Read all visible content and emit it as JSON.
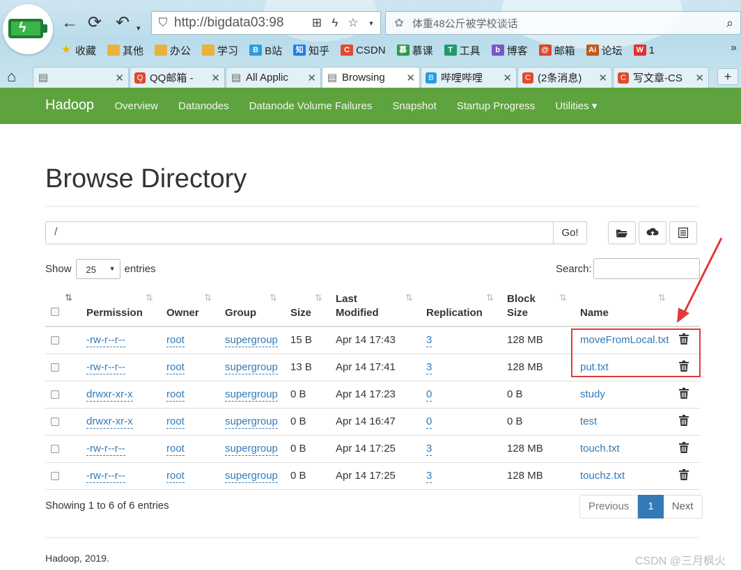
{
  "browser": {
    "url": "http://bigdata03:98",
    "search_text": "体重48公斤被学校谈话",
    "bookmarks": [
      {
        "label": "收藏",
        "icon": "star-icon",
        "color": "#f0b400"
      },
      {
        "label": "其他",
        "icon": "folder-icon",
        "color": "#e8b33a"
      },
      {
        "label": "办公",
        "icon": "folder-icon",
        "color": "#e8b33a"
      },
      {
        "label": "学习",
        "icon": "folder-icon",
        "color": "#e8b33a"
      },
      {
        "label": "B站",
        "icon": "bilibili-icon",
        "color": "#2d9be0"
      },
      {
        "label": "知乎",
        "icon": "zhihu-icon",
        "color": "#1e80e0"
      },
      {
        "label": "CSDN",
        "icon": "csdn-icon",
        "color": "#e24b2a"
      },
      {
        "label": "慕课",
        "icon": "mooc-icon",
        "color": "#2c9a45"
      },
      {
        "label": "工具",
        "icon": "tool-icon",
        "color": "#1f9b6b"
      },
      {
        "label": "博客",
        "icon": "blog-icon",
        "color": "#7b56c4"
      },
      {
        "label": "邮箱",
        "icon": "mail-icon",
        "color": "#d9472b"
      },
      {
        "label": "论坛",
        "icon": "ai-icon",
        "color": "#c05a17"
      },
      {
        "label": "1",
        "icon": "weibo-icon",
        "color": "#e0312f"
      }
    ],
    "tabs": [
      {
        "title": "",
        "icon": "page-icon",
        "color": "#888888",
        "active": false
      },
      {
        "title": "QQ邮箱 -",
        "icon": "qqmail-icon",
        "color": "#e0482c",
        "active": false
      },
      {
        "title": "All Applic",
        "icon": "page-icon",
        "color": "#888888",
        "active": false
      },
      {
        "title": "Browsing",
        "icon": "page-icon",
        "color": "#888888",
        "active": true
      },
      {
        "title": "哔哩哔哩",
        "icon": "bilibili-icon",
        "color": "#2d9be0",
        "active": false
      },
      {
        "title": "(2条消息)",
        "icon": "csdn-icon",
        "color": "#e24b2a",
        "active": false
      },
      {
        "title": "写文章-CS",
        "icon": "csdn-icon",
        "color": "#e24b2a",
        "active": false
      }
    ]
  },
  "navbar": {
    "brand": "Hadoop",
    "links": [
      "Overview",
      "Datanodes",
      "Datanode Volume Failures",
      "Snapshot",
      "Startup Progress",
      "Utilities ▾"
    ]
  },
  "page": {
    "title": "Browse Directory",
    "path": "/",
    "go_label": "Go!",
    "show_label": "Show",
    "entries_label": "entries",
    "page_size": "25",
    "search_label": "Search:"
  },
  "table": {
    "headers": {
      "permission": "Permission",
      "owner": "Owner",
      "group": "Group",
      "size": "Size",
      "last_modified_1": "Last",
      "last_modified_2": "Modified",
      "replication": "Replication",
      "block_size_1": "Block",
      "block_size_2": "Size",
      "name": "Name"
    },
    "rows": [
      {
        "permission": "-rw-r--r--",
        "owner": "root",
        "group": "supergroup",
        "size": "15 B",
        "modified": "Apr 14 17:43",
        "replication": "3",
        "block_size": "128 MB",
        "name": "moveFromLocal.txt"
      },
      {
        "permission": "-rw-r--r--",
        "owner": "root",
        "group": "supergroup",
        "size": "13 B",
        "modified": "Apr 14 17:41",
        "replication": "3",
        "block_size": "128 MB",
        "name": "put.txt"
      },
      {
        "permission": "drwxr-xr-x",
        "owner": "root",
        "group": "supergroup",
        "size": "0 B",
        "modified": "Apr 14 17:23",
        "replication": "0",
        "block_size": "0 B",
        "name": "study"
      },
      {
        "permission": "drwxr-xr-x",
        "owner": "root",
        "group": "supergroup",
        "size": "0 B",
        "modified": "Apr 14 16:47",
        "replication": "0",
        "block_size": "0 B",
        "name": "test"
      },
      {
        "permission": "-rw-r--r--",
        "owner": "root",
        "group": "supergroup",
        "size": "0 B",
        "modified": "Apr 14 17:25",
        "replication": "3",
        "block_size": "128 MB",
        "name": "touch.txt"
      },
      {
        "permission": "-rw-r--r--",
        "owner": "root",
        "group": "supergroup",
        "size": "0 B",
        "modified": "Apr 14 17:25",
        "replication": "3",
        "block_size": "128 MB",
        "name": "touchz.txt"
      }
    ]
  },
  "pagination": {
    "info": "Showing 1 to 6 of 6 entries",
    "previous": "Previous",
    "current": "1",
    "next": "Next"
  },
  "footer": "Hadoop, 2019.",
  "watermark": "CSDN @三月枫火",
  "colors": {
    "navbar": "#5fa33e",
    "link": "#337ab7",
    "annotation": "#e03a3a"
  }
}
